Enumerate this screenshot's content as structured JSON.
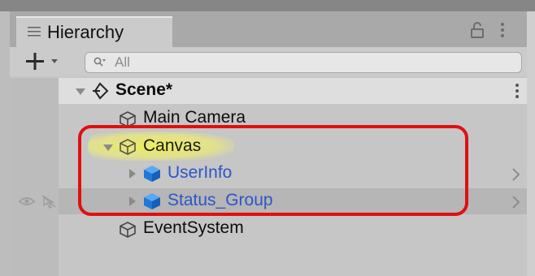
{
  "panel": {
    "tab": {
      "title": "Hierarchy",
      "icon": "list-icon"
    },
    "header_icons": [
      "lock-icon",
      "kebab-menu-icon"
    ]
  },
  "toolbar": {
    "add_icon": "plus-icon",
    "search": {
      "placeholder": "All",
      "icon": "search-icon"
    }
  },
  "tree": {
    "scene": {
      "label": "Scene*",
      "icon": "unity-scene-icon"
    },
    "items": [
      {
        "label": "Main Camera",
        "icon": "gameobject-cube-icon"
      },
      {
        "label": "Canvas",
        "icon": "gameobject-cube-icon",
        "expanded": true,
        "highlighted": true
      },
      {
        "label": "UserInfo",
        "icon": "prefab-cube-icon",
        "prefab": true,
        "color": "#2c55c8"
      },
      {
        "label": "Status_Group",
        "icon": "prefab-cube-icon",
        "prefab": true,
        "color": "#2c55c8"
      },
      {
        "label": "EventSystem",
        "icon": "gameobject-cube-icon"
      }
    ]
  },
  "annotation": {
    "color": "#e01010"
  },
  "colors": {
    "highlight": "#eeee5a",
    "prefab_blue": "#2c55c8",
    "prefab_icon": "#1e78d8"
  }
}
